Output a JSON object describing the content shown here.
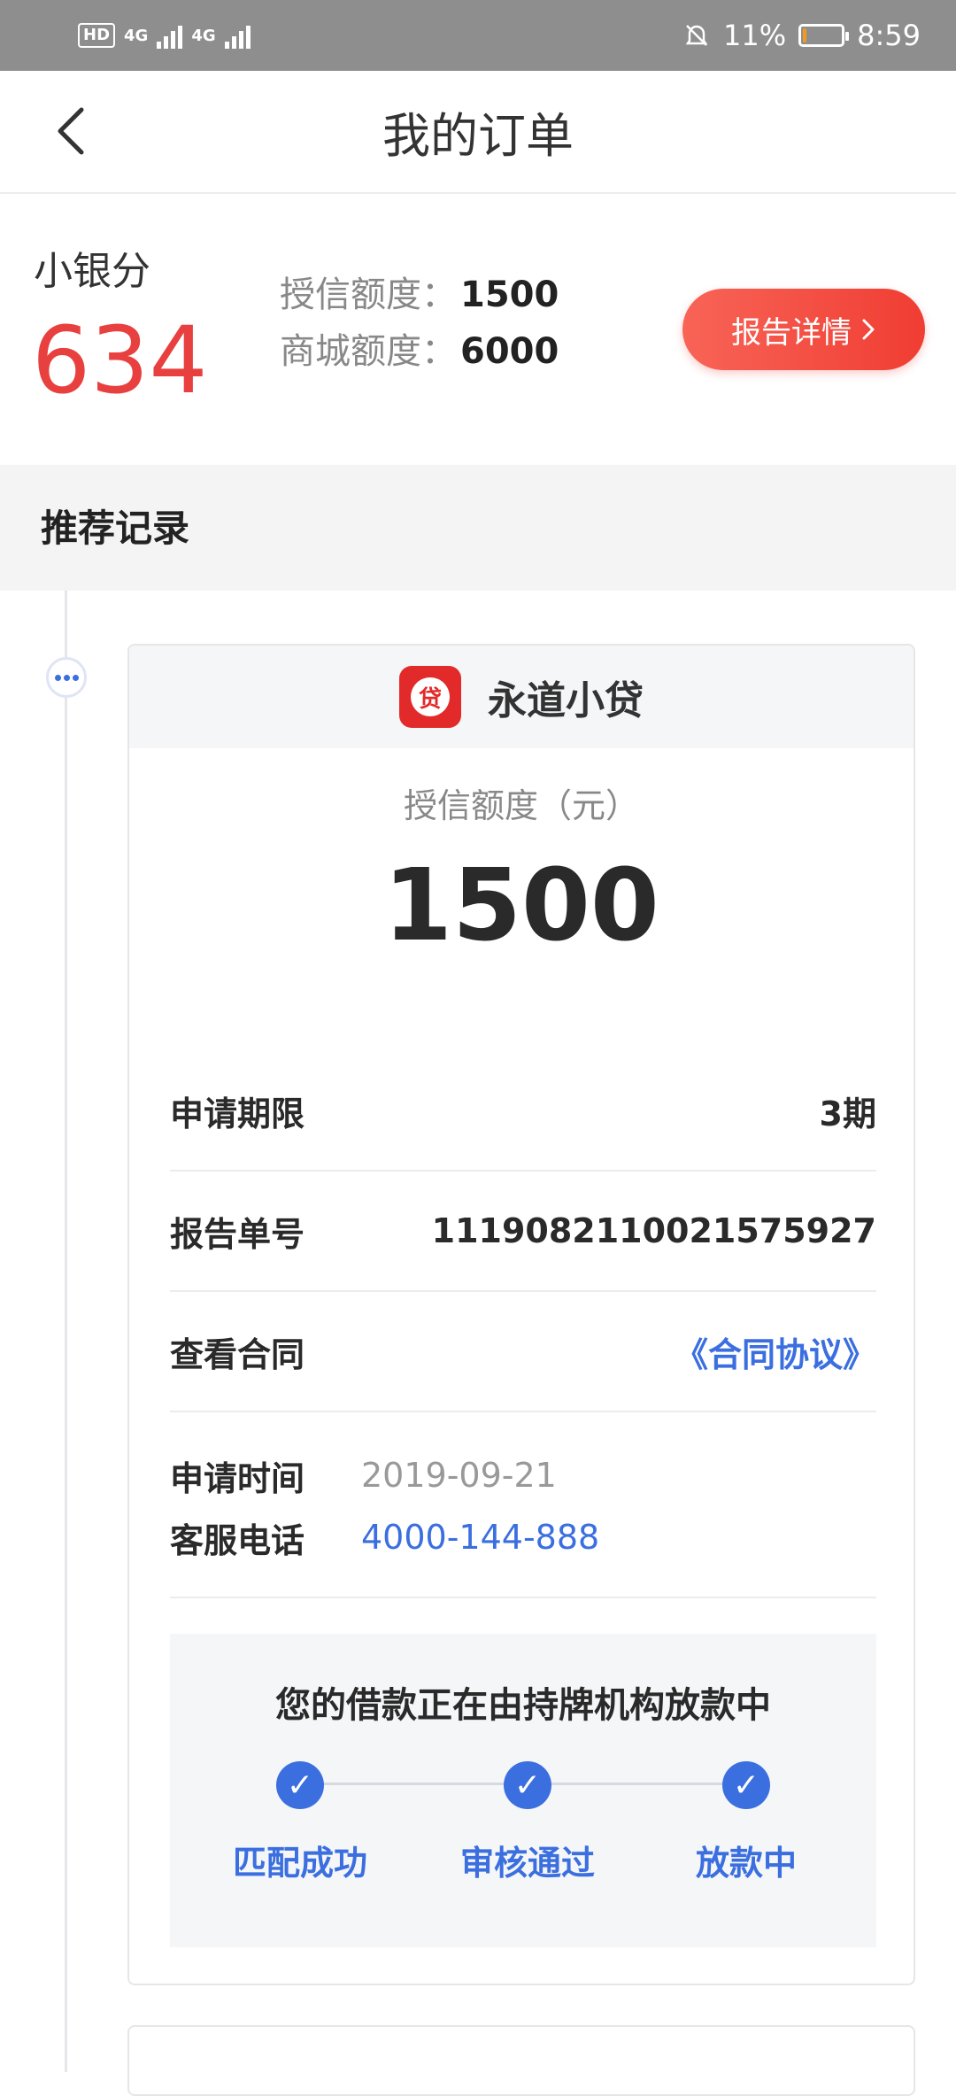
{
  "status_bar": {
    "hd": "HD",
    "network1": "4G",
    "network2": "4G",
    "battery_percent": "11%",
    "battery_level": 0.11,
    "time": "8:59"
  },
  "nav": {
    "title": "我的订单"
  },
  "score": {
    "label": "小银分",
    "value": "634",
    "credit_limit_label": "授信额度：",
    "credit_limit_value": "1500",
    "mall_limit_label": "商城额度：",
    "mall_limit_value": "6000",
    "report_button": "报告详情"
  },
  "section": {
    "title": "推荐记录"
  },
  "order": {
    "lender_logo_text": "贷",
    "lender_name": "永道小贷",
    "amount_label": "授信额度（元）",
    "amount_value": "1500",
    "rows": [
      {
        "key": "申请期限",
        "value": "3期"
      },
      {
        "key": "报告单号",
        "value": "1119082110021575927"
      },
      {
        "key": "查看合同",
        "value": "《合同协议》"
      }
    ],
    "apply_time_label": "申请时间",
    "apply_time_value": "2019-09-21",
    "service_phone_label": "客服电话",
    "service_phone_value": "4000-144-888",
    "status_title": "您的借款正在由持牌机构放款中",
    "steps": [
      {
        "label": "匹配成功"
      },
      {
        "label": "审核通过"
      },
      {
        "label": "放款中"
      }
    ]
  },
  "colors": {
    "accent_red": "#e8403f",
    "accent_blue": "#3b6fe0"
  }
}
